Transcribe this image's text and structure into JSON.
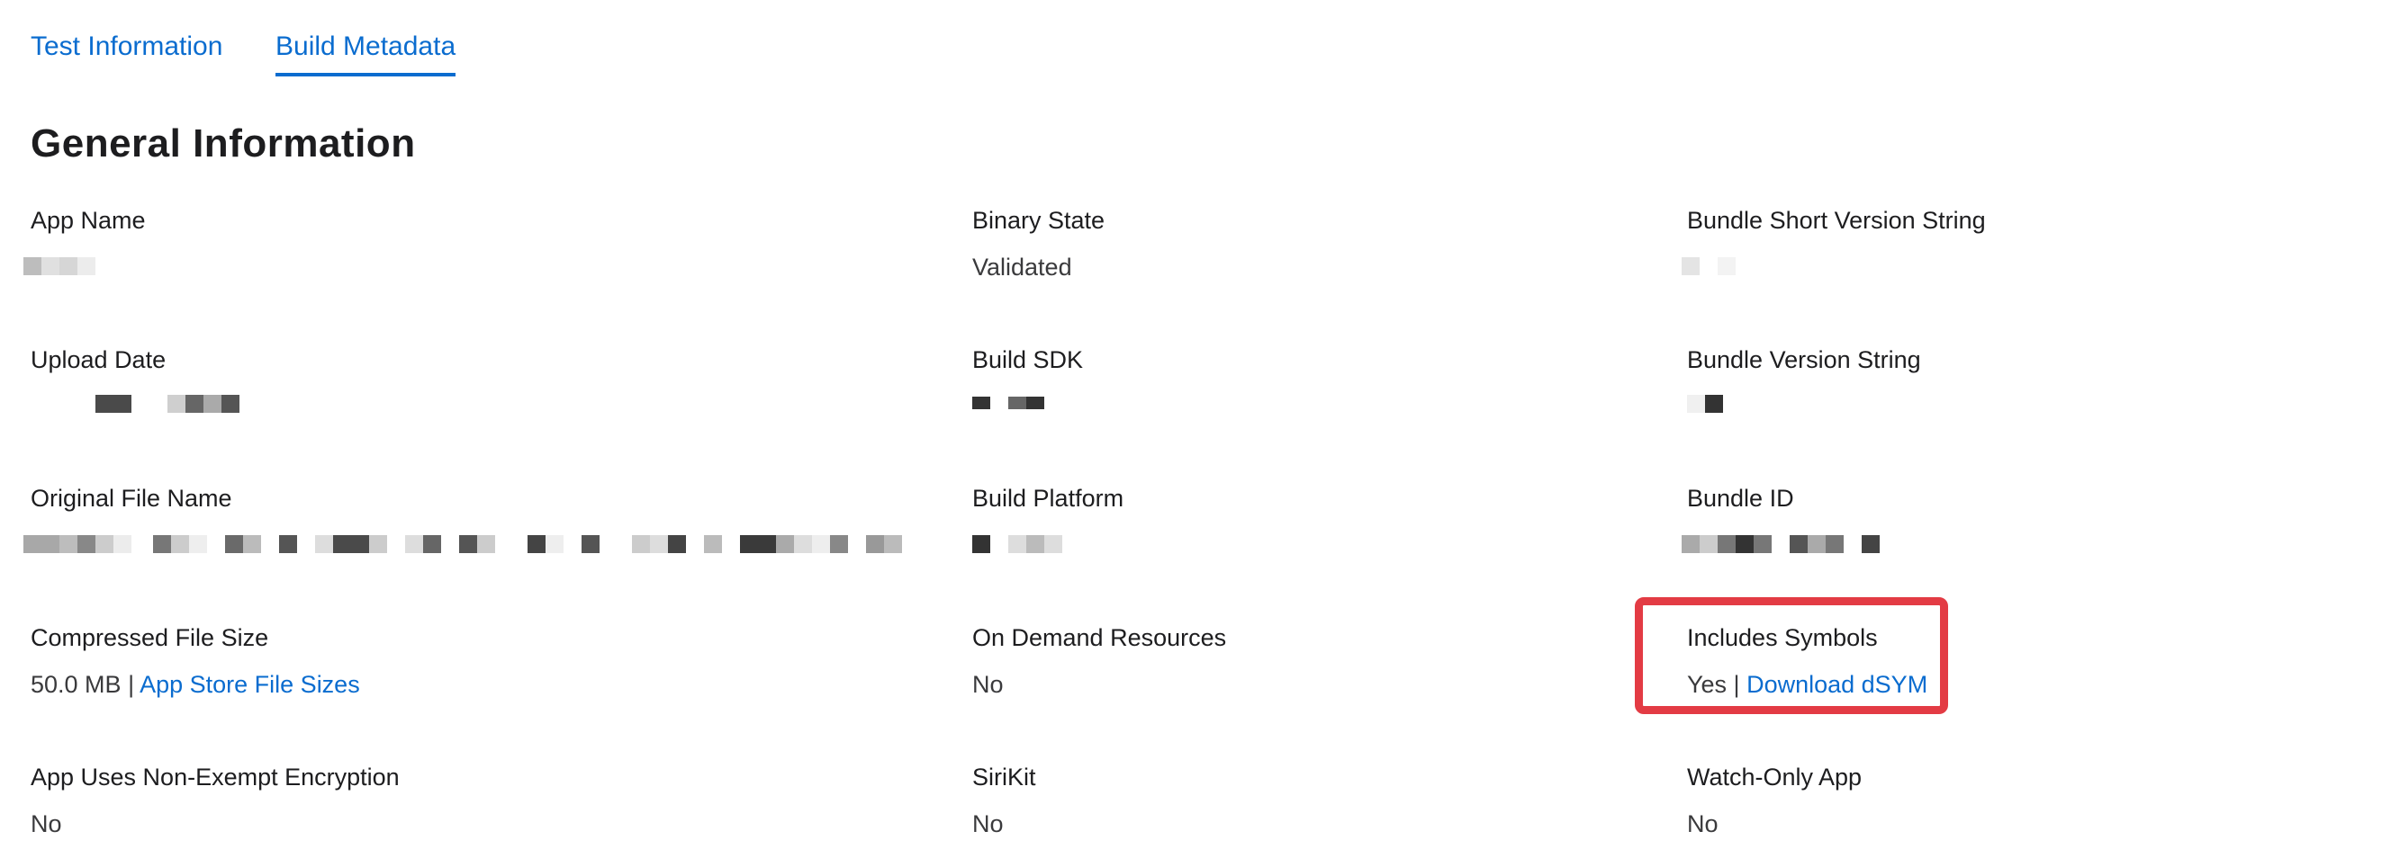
{
  "tabs": [
    {
      "label": "Test Information",
      "active": false
    },
    {
      "label": "Build Metadata",
      "active": true
    }
  ],
  "section_title": "General Information",
  "fields": {
    "app_name": {
      "label": "App Name"
    },
    "binary_state": {
      "label": "Binary State",
      "value": "Validated"
    },
    "bundle_short_version": {
      "label": "Bundle Short Version String"
    },
    "upload_date": {
      "label": "Upload Date"
    },
    "build_sdk": {
      "label": "Build SDK"
    },
    "bundle_version": {
      "label": "Bundle Version String"
    },
    "original_file_name": {
      "label": "Original File Name"
    },
    "build_platform": {
      "label": "Build Platform"
    },
    "bundle_id": {
      "label": "Bundle ID"
    },
    "compressed_file_size": {
      "label": "Compressed File Size",
      "value": "50.0 MB",
      "separator": " | ",
      "link": "App Store File Sizes"
    },
    "on_demand_resources": {
      "label": "On Demand Resources",
      "value": "No"
    },
    "includes_symbols": {
      "label": "Includes Symbols",
      "value": "Yes",
      "separator": " | ",
      "link": "Download dSYM"
    },
    "non_exempt_encryption": {
      "label": "App Uses Non-Exempt Encryption",
      "value": "No"
    },
    "sirikit": {
      "label": "SiriKit",
      "value": "No"
    },
    "watch_only_app": {
      "label": "Watch-Only App",
      "value": "No"
    }
  },
  "colors": {
    "link": "#0a6ccf",
    "highlight": "#e33b44"
  },
  "redacted_note": "Pixelated values shown as grey blocks"
}
